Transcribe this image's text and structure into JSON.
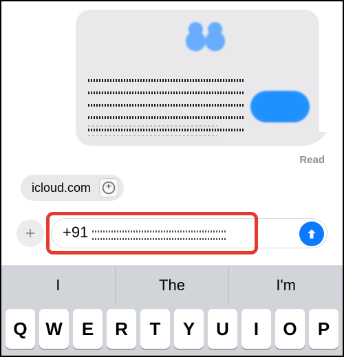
{
  "chat": {
    "read_receipt": "Read"
  },
  "link_preview": {
    "domain": "icloud.com"
  },
  "composer": {
    "prefix": "+91"
  },
  "keyboard": {
    "suggestions": [
      "I",
      "The",
      "I'm"
    ],
    "row1": [
      "Q",
      "W",
      "E",
      "R",
      "T",
      "Y",
      "U",
      "I",
      "O",
      "P"
    ]
  }
}
